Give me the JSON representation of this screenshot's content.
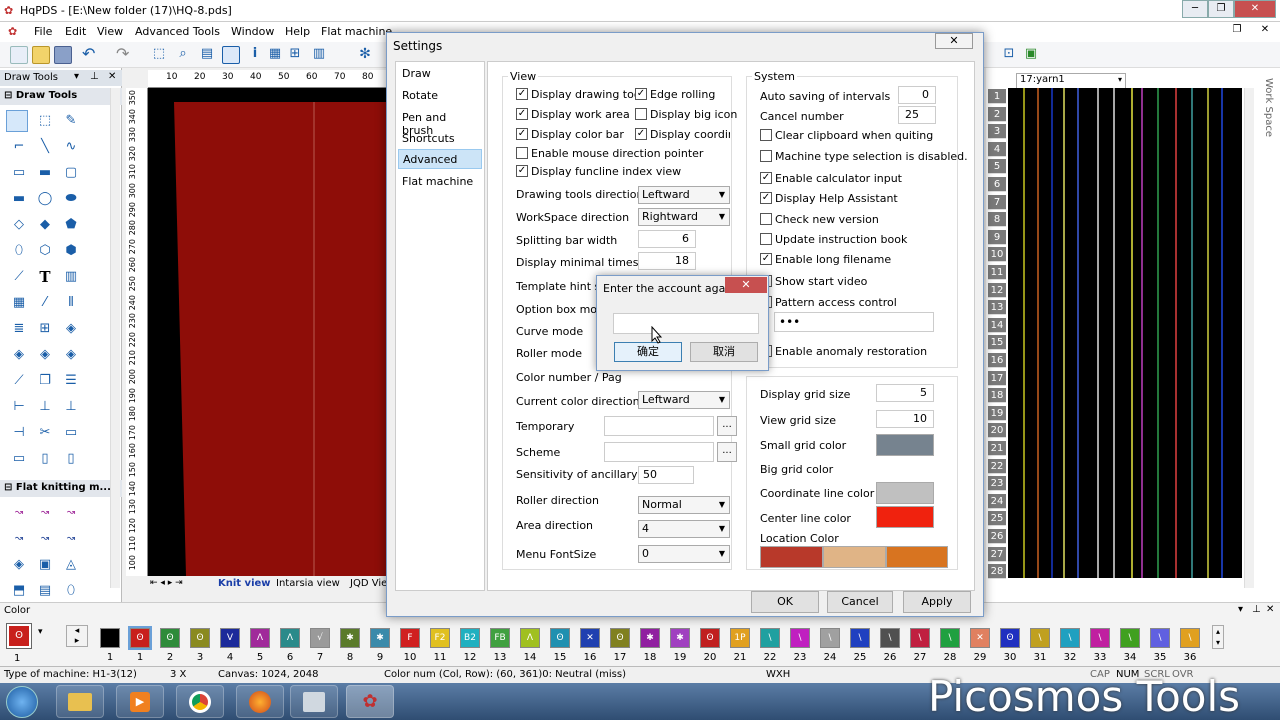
{
  "app": {
    "title": "HqPDS - [E:\\New folder (17)\\HQ-8.pds]",
    "menu": [
      "File",
      "Edit",
      "View",
      "Advanced Tools",
      "Window",
      "Help",
      "Flat machine"
    ]
  },
  "left_panel": {
    "header": "Draw Tools",
    "section1": "Draw Tools",
    "section2": "Flat knitting m..."
  },
  "ruler": {
    "top": [
      "10",
      "20",
      "30",
      "40",
      "50",
      "60",
      "70",
      "80"
    ],
    "left": [
      "350",
      "340",
      "330",
      "320",
      "310",
      "300",
      "290",
      "280",
      "270",
      "260",
      "250",
      "240",
      "230",
      "220",
      "210",
      "200",
      "190",
      "180",
      "170",
      "160",
      "150",
      "140",
      "130",
      "120",
      "110",
      "100"
    ]
  },
  "canvas_tabs": [
    "Knit view",
    "Intarsia view",
    "JQD Vie"
  ],
  "right_panel": {
    "yarn_select": "17:yarn1",
    "side_label": "Work Space",
    "rows": [
      "1",
      "2",
      "3",
      "4",
      "5",
      "6",
      "7",
      "8",
      "9",
      "10",
      "11",
      "12",
      "13",
      "14",
      "15",
      "16",
      "17",
      "18",
      "19",
      "20",
      "21",
      "22",
      "23",
      "24",
      "25",
      "26",
      "27",
      "28"
    ]
  },
  "color_bar": {
    "label": "Color",
    "current": "1",
    "cells": [
      {
        "n": "1",
        "c": "#000000",
        "t": ""
      },
      {
        "n": "1",
        "c": "#c8201c",
        "t": "ʘ"
      },
      {
        "n": "2",
        "c": "#2e8b3a",
        "t": "ʘ"
      },
      {
        "n": "3",
        "c": "#8a8a20",
        "t": "ʘ"
      },
      {
        "n": "4",
        "c": "#1c2a9a",
        "t": "V"
      },
      {
        "n": "5",
        "c": "#a02a9a",
        "t": "Λ"
      },
      {
        "n": "6",
        "c": "#2a8a8a",
        "t": "Λ"
      },
      {
        "n": "7",
        "c": "#9a9a9a",
        "t": "√"
      },
      {
        "n": "8",
        "c": "#5a7a2a",
        "t": "✱"
      },
      {
        "n": "9",
        "c": "#3a8aaa",
        "t": "✱"
      },
      {
        "n": "10",
        "c": "#d02020",
        "t": "F"
      },
      {
        "n": "11",
        "c": "#e0c020",
        "t": "F2"
      },
      {
        "n": "12",
        "c": "#20b0c0",
        "t": "B2"
      },
      {
        "n": "13",
        "c": "#40a040",
        "t": "FB"
      },
      {
        "n": "14",
        "c": "#a0c020",
        "t": "Λ"
      },
      {
        "n": "15",
        "c": "#2090b0",
        "t": "ʘ"
      },
      {
        "n": "16",
        "c": "#2040b0",
        "t": "✕"
      },
      {
        "n": "17",
        "c": "#808020",
        "t": "ʘ"
      },
      {
        "n": "18",
        "c": "#9020a0",
        "t": "✱"
      },
      {
        "n": "19",
        "c": "#a040c0",
        "t": "✱"
      },
      {
        "n": "20",
        "c": "#c02020",
        "t": "ʘ"
      },
      {
        "n": "21",
        "c": "#e0a020",
        "t": "1P"
      },
      {
        "n": "22",
        "c": "#20a0a0",
        "t": "\\"
      },
      {
        "n": "23",
        "c": "#c020c0",
        "t": "\\"
      },
      {
        "n": "24",
        "c": "#a0a0a0",
        "t": "\\"
      },
      {
        "n": "25",
        "c": "#2040c0",
        "t": "\\"
      },
      {
        "n": "26",
        "c": "#505050",
        "t": "\\"
      },
      {
        "n": "27",
        "c": "#c02040",
        "t": "\\"
      },
      {
        "n": "28",
        "c": "#20a040",
        "t": "\\"
      },
      {
        "n": "29",
        "c": "#e08060",
        "t": "✕"
      },
      {
        "n": "30",
        "c": "#2030c0",
        "t": "ʘ"
      },
      {
        "n": "31",
        "c": "#c0a020",
        "t": "\\"
      },
      {
        "n": "32",
        "c": "#20a0c0",
        "t": "\\"
      },
      {
        "n": "33",
        "c": "#c020a0",
        "t": "\\"
      },
      {
        "n": "34",
        "c": "#40a020",
        "t": "\\"
      },
      {
        "n": "35",
        "c": "#6060e0",
        "t": "\\"
      },
      {
        "n": "36",
        "c": "#e0a020",
        "t": "\\"
      }
    ]
  },
  "status": {
    "machine": "Type of machine: H1-3(12)",
    "zoom": "3 X",
    "canvas": "Canvas: 1024, 2048",
    "colornum": "Color num  (Col, Row): (60, 361)0: Neutral (miss)",
    "wxh": "WXH",
    "cap": "CAP",
    "num": "NUM",
    "scrl": "SCRL",
    "ovr": "OVR"
  },
  "watermark": "Picosmos Tools",
  "settings": {
    "title": "Settings",
    "close": "✕",
    "nav": [
      "Draw",
      "Rotate",
      "Pen and brush",
      "Shortcuts",
      "Advanced",
      "Flat machine"
    ],
    "view_title": "View",
    "view_checks": [
      {
        "label": "Display drawing too",
        "checked": "✓"
      },
      {
        "label": "Edge rolling",
        "checked": "✓"
      },
      {
        "label": "Display work area",
        "checked": "✓"
      },
      {
        "label": "Display big icon",
        "checked": ""
      },
      {
        "label": "Display color bar",
        "checked": "✓"
      },
      {
        "label": "Display coordinate li",
        "checked": "✓"
      },
      {
        "label": "Enable mouse direction pointer",
        "checked": ""
      },
      {
        "label": "Display funcline index view",
        "checked": "✓"
      }
    ],
    "drawing_tools_direction": {
      "label": "Drawing tools direction",
      "value": "Leftward"
    },
    "workspace_direction": {
      "label": "WorkSpace direction",
      "value": "Rightward"
    },
    "splitting_bar_width": {
      "label": "Splitting bar width",
      "value": "6"
    },
    "display_minimal_times": {
      "label": "Display minimal times of",
      "value": "18"
    },
    "template_hint_size": {
      "label": "Template hint size"
    },
    "option_box_mode": {
      "label": "Option box mode"
    },
    "curve_mode": {
      "label": "Curve mode"
    },
    "roller_mode": {
      "label": "Roller mode"
    },
    "color_number_page": {
      "label": "Color number / Pag"
    },
    "current_color_direction": {
      "label": "Current color direction",
      "value": "Leftward"
    },
    "temporary": {
      "label": "Temporary",
      "button": "..."
    },
    "scheme": {
      "label": "Scheme",
      "button": "..."
    },
    "sensitivity": {
      "label": "Sensitivity of ancillary",
      "value": "50"
    },
    "roller_direction": {
      "label": "Roller direction",
      "value": "Normal"
    },
    "area_direction": {
      "label": "Area direction",
      "value": "4"
    },
    "menu_fontsize": {
      "label": "Menu FontSize",
      "value": "0"
    },
    "system_title": "System",
    "auto_saving": {
      "label": "Auto saving of intervals",
      "value": "0"
    },
    "cancel_number": {
      "label": "Cancel number",
      "value": "25"
    },
    "system_checks": [
      {
        "label": "Clear clipboard when quiting",
        "checked": ""
      },
      {
        "label": "Machine type selection is disabled.",
        "checked": ""
      },
      {
        "label": "Enable calculator input",
        "checked": "✓"
      },
      {
        "label": "Display Help Assistant",
        "checked": "✓"
      },
      {
        "label": "Check new version",
        "checked": ""
      },
      {
        "label": "Update instruction book",
        "checked": ""
      },
      {
        "label": "Enable long filename",
        "checked": "✓"
      },
      {
        "label": "Show start video",
        "checked": ""
      },
      {
        "label": "Pattern access control",
        "checked": ""
      }
    ],
    "password_mask": "•••",
    "anomaly": {
      "label": "Enable anomaly restoration",
      "checked": ""
    },
    "display_grid_size": {
      "label": "Display grid size",
      "value": "5"
    },
    "view_grid_size": {
      "label": "View grid size",
      "value": "10"
    },
    "small_grid_color": {
      "label": "Small grid color",
      "color": "#76838f"
    },
    "big_grid_color": {
      "label": "Big grid color"
    },
    "coordinate_line_color": {
      "label": "Coordinate line color",
      "color": "#c0c0c0"
    },
    "center_line_color": {
      "label": "Center line color",
      "color": "#f0220e"
    },
    "location_color": {
      "label": "Location Color",
      "colors": [
        "#b8392a",
        "#e0b486",
        "#d87420"
      ]
    },
    "ok": "OK",
    "cancel": "Cancel",
    "apply": "Apply"
  },
  "account_dialog": {
    "title": "Enter the account again.",
    "close": "✕",
    "value": "",
    "confirm": "确定",
    "cancel": "取消"
  }
}
